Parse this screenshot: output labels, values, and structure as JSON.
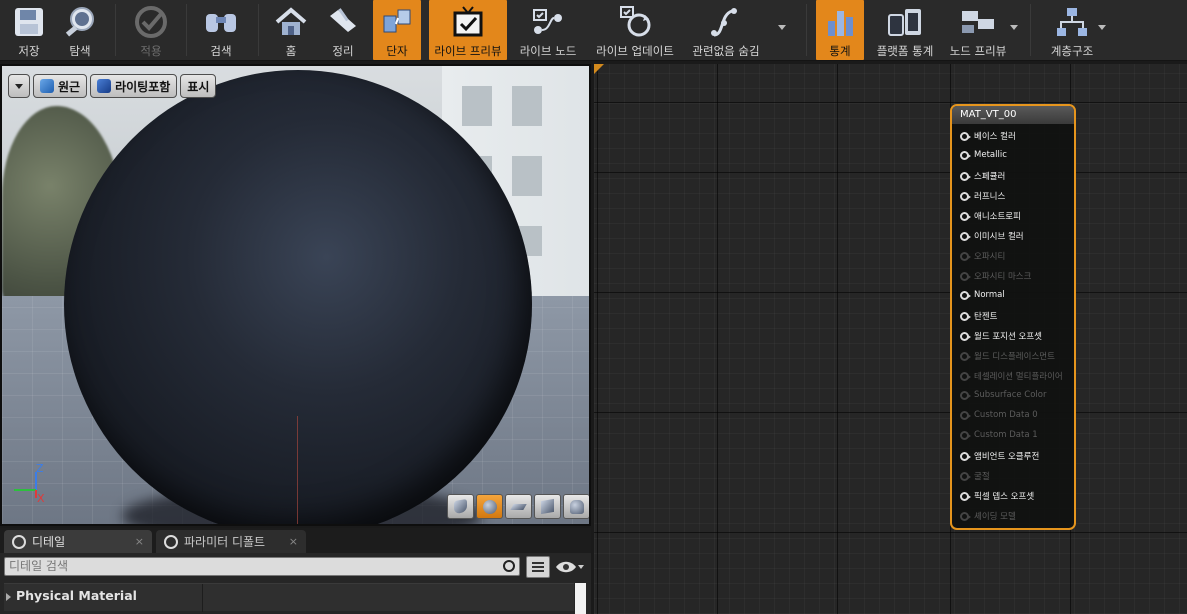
{
  "toolbar": {
    "buttons": [
      {
        "label": "저장",
        "icon": "save-icon"
      },
      {
        "label": "탐색",
        "icon": "browse-icon"
      },
      {
        "label": "적용",
        "icon": "apply-icon",
        "disabled": true
      },
      {
        "label": "검색",
        "icon": "search-icon"
      },
      {
        "label": "홈",
        "icon": "home-icon"
      },
      {
        "label": "정리",
        "icon": "clean-up-icon"
      },
      {
        "label": "단자",
        "icon": "connectors-icon",
        "active": true
      },
      {
        "label": "라이브 프리뷰",
        "icon": "live-preview-icon",
        "active": true
      },
      {
        "label": "라이브 노드",
        "icon": "live-nodes-icon"
      },
      {
        "label": "라이브 업데이트",
        "icon": "live-update-icon"
      },
      {
        "label": "관련없음 숨김",
        "icon": "hide-unrelated-icon"
      },
      {
        "label": "통계",
        "icon": "stats-icon",
        "active": true
      },
      {
        "label": "플랫폼 통계",
        "icon": "platform-stats-icon"
      },
      {
        "label": "노드 프리뷰",
        "icon": "node-preview-icon"
      },
      {
        "label": "계층구조",
        "icon": "hierarchy-icon"
      }
    ]
  },
  "viewport": {
    "buttons": {
      "perspective": "원근",
      "lit": "라이팅포함",
      "show": "표시"
    },
    "axis": {
      "z": "Z",
      "x": "X"
    },
    "accent": "#e3871b"
  },
  "details": {
    "tabs": [
      {
        "label": "디테일",
        "close": "×"
      },
      {
        "label": "파라미터 디폴트",
        "close": "×"
      }
    ],
    "search_placeholder": "디테일 검색",
    "category": "Physical Material"
  },
  "node": {
    "title": "MAT_VT_00",
    "border_color": "#e6951d",
    "pins": [
      {
        "label": "베이스 컬러",
        "enabled": true
      },
      {
        "label": "Metallic",
        "enabled": true
      },
      {
        "label": "스페큘러",
        "enabled": true
      },
      {
        "label": "러프니스",
        "enabled": true
      },
      {
        "label": "애니소트로피",
        "enabled": true
      },
      {
        "label": "이미시브 컬러",
        "enabled": true
      },
      {
        "label": "오파시티",
        "enabled": false
      },
      {
        "label": "오파시티 마스크",
        "enabled": false
      },
      {
        "label": "Normal",
        "enabled": true
      },
      {
        "label": "탄젠트",
        "enabled": true
      },
      {
        "label": "월드 포지션 오프셋",
        "enabled": true
      },
      {
        "label": "월드 디스플레이스먼트",
        "enabled": false
      },
      {
        "label": "테셀레이션 멀티플라이어",
        "enabled": false
      },
      {
        "label": "Subsurface Color",
        "enabled": false
      },
      {
        "label": "Custom Data 0",
        "enabled": false
      },
      {
        "label": "Custom Data 1",
        "enabled": false
      },
      {
        "label": "앰비언트 오클루전",
        "enabled": true
      },
      {
        "label": "굴절",
        "enabled": false
      },
      {
        "label": "픽셀 뎁스 오프셋",
        "enabled": true
      },
      {
        "label": "셰이딩 모델",
        "enabled": false
      }
    ]
  }
}
